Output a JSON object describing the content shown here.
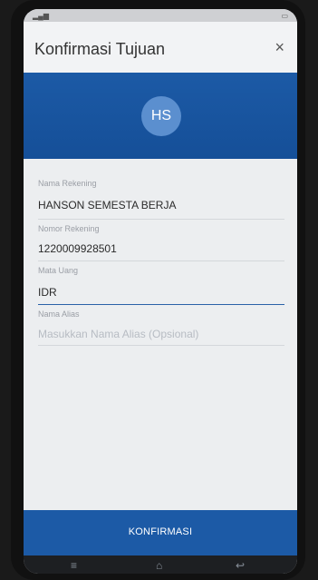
{
  "header": {
    "title": "Konfirmasi Tujuan",
    "close_glyph": "×"
  },
  "avatar": {
    "initials": "HS"
  },
  "fields": [
    {
      "label": "Nama Rekening",
      "value": "HANSON SEMESTA BERJA"
    },
    {
      "label": "Nomor Rekening",
      "value": "1220009928501"
    },
    {
      "label": "Mata Uang",
      "value": "IDR"
    },
    {
      "label": "Nama Alias",
      "placeholder": "Masukkan Nama Alias (Opsional)"
    }
  ],
  "actions": {
    "confirm_label": "KONFIRMASI"
  },
  "nav": {
    "menu_glyph": "≡",
    "home_glyph": "⌂",
    "back_glyph": "↩"
  }
}
